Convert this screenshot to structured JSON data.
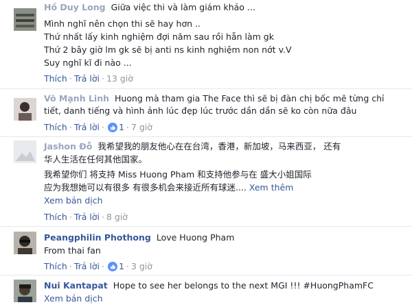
{
  "comments": [
    {
      "author": "Hồ Duy Long",
      "first_line": "Giữa việc thi và làm giám khảo ...",
      "lines": [
        "Mình nghĩ nên chọn thi sẽ hay hơn ..",
        "Thứ nhất lấy kinh nghiệm đợi năm sau rồi hẵn làm gk",
        "Thứ 2 bây giờ lm gk sẽ bị anti ns kinh nghiệm non nớt v.V",
        "Suy nghĩ kĩ đi nào ..."
      ],
      "like_label": "Thích",
      "reply_label": "Trả lời",
      "time": "13 giờ"
    },
    {
      "author": "Võ Mạnh Linh",
      "first_line": "Huong mà tham gia The Face thì sẽ bị đàn chị bốc mẽ từng chỉ",
      "lines": [
        "tiết, danh tiếng và hình ảnh lúc đẹp lúc trước dần dần sẽ ko còn nữa đâu"
      ],
      "like_label": "Thích",
      "reply_label": "Trả lời",
      "like_count": "1",
      "time": "7 giờ"
    },
    {
      "author": "Jashon Đỗ",
      "first_line": "我希望我的朋友他心在在台湾，香港，新加坡，马来西亚， 还有",
      "lines": [
        "华人生活在任何其他国家。",
        "我希望你们 将支持 Miss Huong Pham 和支持他参与在 盛大小姐国际",
        "应为我想她可以有很多 有很多机会来接近所有球迷...."
      ],
      "see_more": "Xem thêm",
      "translate": "Xem bản dịch",
      "like_label": "Thích",
      "reply_label": "Trả lời",
      "time": "8 giờ"
    },
    {
      "author": "Peangphilin Phothong",
      "first_line": "Love Huong Pham",
      "lines": [
        "From thai fan"
      ],
      "like_label": "Thích",
      "reply_label": "Trả lời",
      "like_count": "1",
      "time": "3 giờ"
    },
    {
      "author": "Nui Kantapat",
      "first_line": "Hope to see her belongs to the next MGI !!! #HuongPhamFC",
      "translate": "Xem bản dịch"
    }
  ],
  "colors": {
    "link": "#365899",
    "meta": "#90949c",
    "text": "#1d2129",
    "like_badge": "#5890ff"
  },
  "icons": {
    "like": "thumbs-up-icon"
  }
}
